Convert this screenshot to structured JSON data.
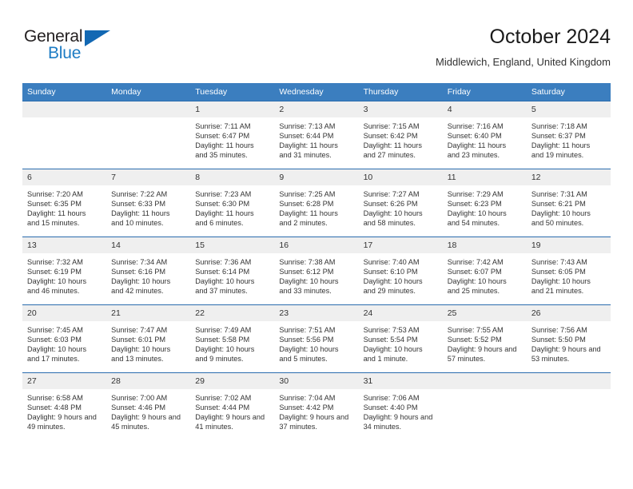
{
  "brand": {
    "name_part1": "General",
    "name_part2": "Blue",
    "triangle_color": "#1268b3",
    "blue_color": "#1d7cc4"
  },
  "header": {
    "title": "October 2024",
    "subtitle": "Middlewich, England, United Kingdom"
  },
  "theme": {
    "header_bg": "#3b7ebf",
    "row_divider": "#2a6cae",
    "daynum_bg": "#efefef",
    "text": "#333333"
  },
  "weekdays": [
    "Sunday",
    "Monday",
    "Tuesday",
    "Wednesday",
    "Thursday",
    "Friday",
    "Saturday"
  ],
  "weeks": [
    [
      {
        "day": "",
        "sunrise": "",
        "sunset": "",
        "daylight": ""
      },
      {
        "day": "",
        "sunrise": "",
        "sunset": "",
        "daylight": ""
      },
      {
        "day": "1",
        "sunrise": "Sunrise: 7:11 AM",
        "sunset": "Sunset: 6:47 PM",
        "daylight": "Daylight: 11 hours and 35 minutes."
      },
      {
        "day": "2",
        "sunrise": "Sunrise: 7:13 AM",
        "sunset": "Sunset: 6:44 PM",
        "daylight": "Daylight: 11 hours and 31 minutes."
      },
      {
        "day": "3",
        "sunrise": "Sunrise: 7:15 AM",
        "sunset": "Sunset: 6:42 PM",
        "daylight": "Daylight: 11 hours and 27 minutes."
      },
      {
        "day": "4",
        "sunrise": "Sunrise: 7:16 AM",
        "sunset": "Sunset: 6:40 PM",
        "daylight": "Daylight: 11 hours and 23 minutes."
      },
      {
        "day": "5",
        "sunrise": "Sunrise: 7:18 AM",
        "sunset": "Sunset: 6:37 PM",
        "daylight": "Daylight: 11 hours and 19 minutes."
      }
    ],
    [
      {
        "day": "6",
        "sunrise": "Sunrise: 7:20 AM",
        "sunset": "Sunset: 6:35 PM",
        "daylight": "Daylight: 11 hours and 15 minutes."
      },
      {
        "day": "7",
        "sunrise": "Sunrise: 7:22 AM",
        "sunset": "Sunset: 6:33 PM",
        "daylight": "Daylight: 11 hours and 10 minutes."
      },
      {
        "day": "8",
        "sunrise": "Sunrise: 7:23 AM",
        "sunset": "Sunset: 6:30 PM",
        "daylight": "Daylight: 11 hours and 6 minutes."
      },
      {
        "day": "9",
        "sunrise": "Sunrise: 7:25 AM",
        "sunset": "Sunset: 6:28 PM",
        "daylight": "Daylight: 11 hours and 2 minutes."
      },
      {
        "day": "10",
        "sunrise": "Sunrise: 7:27 AM",
        "sunset": "Sunset: 6:26 PM",
        "daylight": "Daylight: 10 hours and 58 minutes."
      },
      {
        "day": "11",
        "sunrise": "Sunrise: 7:29 AM",
        "sunset": "Sunset: 6:23 PM",
        "daylight": "Daylight: 10 hours and 54 minutes."
      },
      {
        "day": "12",
        "sunrise": "Sunrise: 7:31 AM",
        "sunset": "Sunset: 6:21 PM",
        "daylight": "Daylight: 10 hours and 50 minutes."
      }
    ],
    [
      {
        "day": "13",
        "sunrise": "Sunrise: 7:32 AM",
        "sunset": "Sunset: 6:19 PM",
        "daylight": "Daylight: 10 hours and 46 minutes."
      },
      {
        "day": "14",
        "sunrise": "Sunrise: 7:34 AM",
        "sunset": "Sunset: 6:16 PM",
        "daylight": "Daylight: 10 hours and 42 minutes."
      },
      {
        "day": "15",
        "sunrise": "Sunrise: 7:36 AM",
        "sunset": "Sunset: 6:14 PM",
        "daylight": "Daylight: 10 hours and 37 minutes."
      },
      {
        "day": "16",
        "sunrise": "Sunrise: 7:38 AM",
        "sunset": "Sunset: 6:12 PM",
        "daylight": "Daylight: 10 hours and 33 minutes."
      },
      {
        "day": "17",
        "sunrise": "Sunrise: 7:40 AM",
        "sunset": "Sunset: 6:10 PM",
        "daylight": "Daylight: 10 hours and 29 minutes."
      },
      {
        "day": "18",
        "sunrise": "Sunrise: 7:42 AM",
        "sunset": "Sunset: 6:07 PM",
        "daylight": "Daylight: 10 hours and 25 minutes."
      },
      {
        "day": "19",
        "sunrise": "Sunrise: 7:43 AM",
        "sunset": "Sunset: 6:05 PM",
        "daylight": "Daylight: 10 hours and 21 minutes."
      }
    ],
    [
      {
        "day": "20",
        "sunrise": "Sunrise: 7:45 AM",
        "sunset": "Sunset: 6:03 PM",
        "daylight": "Daylight: 10 hours and 17 minutes."
      },
      {
        "day": "21",
        "sunrise": "Sunrise: 7:47 AM",
        "sunset": "Sunset: 6:01 PM",
        "daylight": "Daylight: 10 hours and 13 minutes."
      },
      {
        "day": "22",
        "sunrise": "Sunrise: 7:49 AM",
        "sunset": "Sunset: 5:58 PM",
        "daylight": "Daylight: 10 hours and 9 minutes."
      },
      {
        "day": "23",
        "sunrise": "Sunrise: 7:51 AM",
        "sunset": "Sunset: 5:56 PM",
        "daylight": "Daylight: 10 hours and 5 minutes."
      },
      {
        "day": "24",
        "sunrise": "Sunrise: 7:53 AM",
        "sunset": "Sunset: 5:54 PM",
        "daylight": "Daylight: 10 hours and 1 minute."
      },
      {
        "day": "25",
        "sunrise": "Sunrise: 7:55 AM",
        "sunset": "Sunset: 5:52 PM",
        "daylight": "Daylight: 9 hours and 57 minutes."
      },
      {
        "day": "26",
        "sunrise": "Sunrise: 7:56 AM",
        "sunset": "Sunset: 5:50 PM",
        "daylight": "Daylight: 9 hours and 53 minutes."
      }
    ],
    [
      {
        "day": "27",
        "sunrise": "Sunrise: 6:58 AM",
        "sunset": "Sunset: 4:48 PM",
        "daylight": "Daylight: 9 hours and 49 minutes."
      },
      {
        "day": "28",
        "sunrise": "Sunrise: 7:00 AM",
        "sunset": "Sunset: 4:46 PM",
        "daylight": "Daylight: 9 hours and 45 minutes."
      },
      {
        "day": "29",
        "sunrise": "Sunrise: 7:02 AM",
        "sunset": "Sunset: 4:44 PM",
        "daylight": "Daylight: 9 hours and 41 minutes."
      },
      {
        "day": "30",
        "sunrise": "Sunrise: 7:04 AM",
        "sunset": "Sunset: 4:42 PM",
        "daylight": "Daylight: 9 hours and 37 minutes."
      },
      {
        "day": "31",
        "sunrise": "Sunrise: 7:06 AM",
        "sunset": "Sunset: 4:40 PM",
        "daylight": "Daylight: 9 hours and 34 minutes."
      },
      {
        "day": "",
        "sunrise": "",
        "sunset": "",
        "daylight": ""
      },
      {
        "day": "",
        "sunrise": "",
        "sunset": "",
        "daylight": ""
      }
    ]
  ]
}
